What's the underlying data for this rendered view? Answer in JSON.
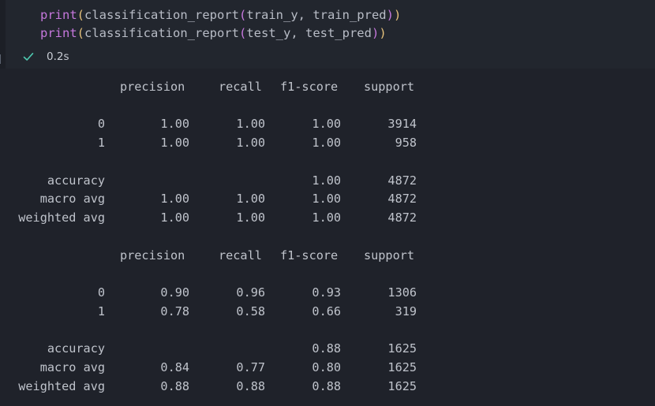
{
  "code": {
    "line1": {
      "fn": "print",
      "open1": "(",
      "inner_fn": "classification_report",
      "open2": "(",
      "args": "train_y, train_pred",
      "close2": ")",
      "close1": ")"
    },
    "line2": {
      "fn": "print",
      "open1": "(",
      "inner_fn": "classification_report",
      "open2": "(",
      "args": "test_y, test_pred",
      "close2": ")",
      "close1": ")"
    }
  },
  "status": {
    "icon": "check-icon",
    "time": "0.2s",
    "check_color": "#4ec9b0"
  },
  "reports": [
    {
      "headers": [
        "precision",
        "recall",
        "f1-score",
        "support"
      ],
      "rows": [
        {
          "label": "0",
          "precision": "1.00",
          "recall": "1.00",
          "f1": "1.00",
          "support": "3914"
        },
        {
          "label": "1",
          "precision": "1.00",
          "recall": "1.00",
          "f1": "1.00",
          "support": "958"
        },
        {
          "label": "accuracy",
          "precision": "",
          "recall": "",
          "f1": "1.00",
          "support": "4872"
        },
        {
          "label": "macro avg",
          "precision": "1.00",
          "recall": "1.00",
          "f1": "1.00",
          "support": "4872"
        },
        {
          "label": "weighted avg",
          "precision": "1.00",
          "recall": "1.00",
          "f1": "1.00",
          "support": "4872"
        }
      ]
    },
    {
      "headers": [
        "precision",
        "recall",
        "f1-score",
        "support"
      ],
      "rows": [
        {
          "label": "0",
          "precision": "0.90",
          "recall": "0.96",
          "f1": "0.93",
          "support": "1306"
        },
        {
          "label": "1",
          "precision": "0.78",
          "recall": "0.58",
          "f1": "0.66",
          "support": "319"
        },
        {
          "label": "accuracy",
          "precision": "",
          "recall": "",
          "f1": "0.88",
          "support": "1625"
        },
        {
          "label": "macro avg",
          "precision": "0.84",
          "recall": "0.77",
          "f1": "0.80",
          "support": "1625"
        },
        {
          "label": "weighted avg",
          "precision": "0.88",
          "recall": "0.88",
          "f1": "0.88",
          "support": "1625"
        }
      ]
    }
  ]
}
